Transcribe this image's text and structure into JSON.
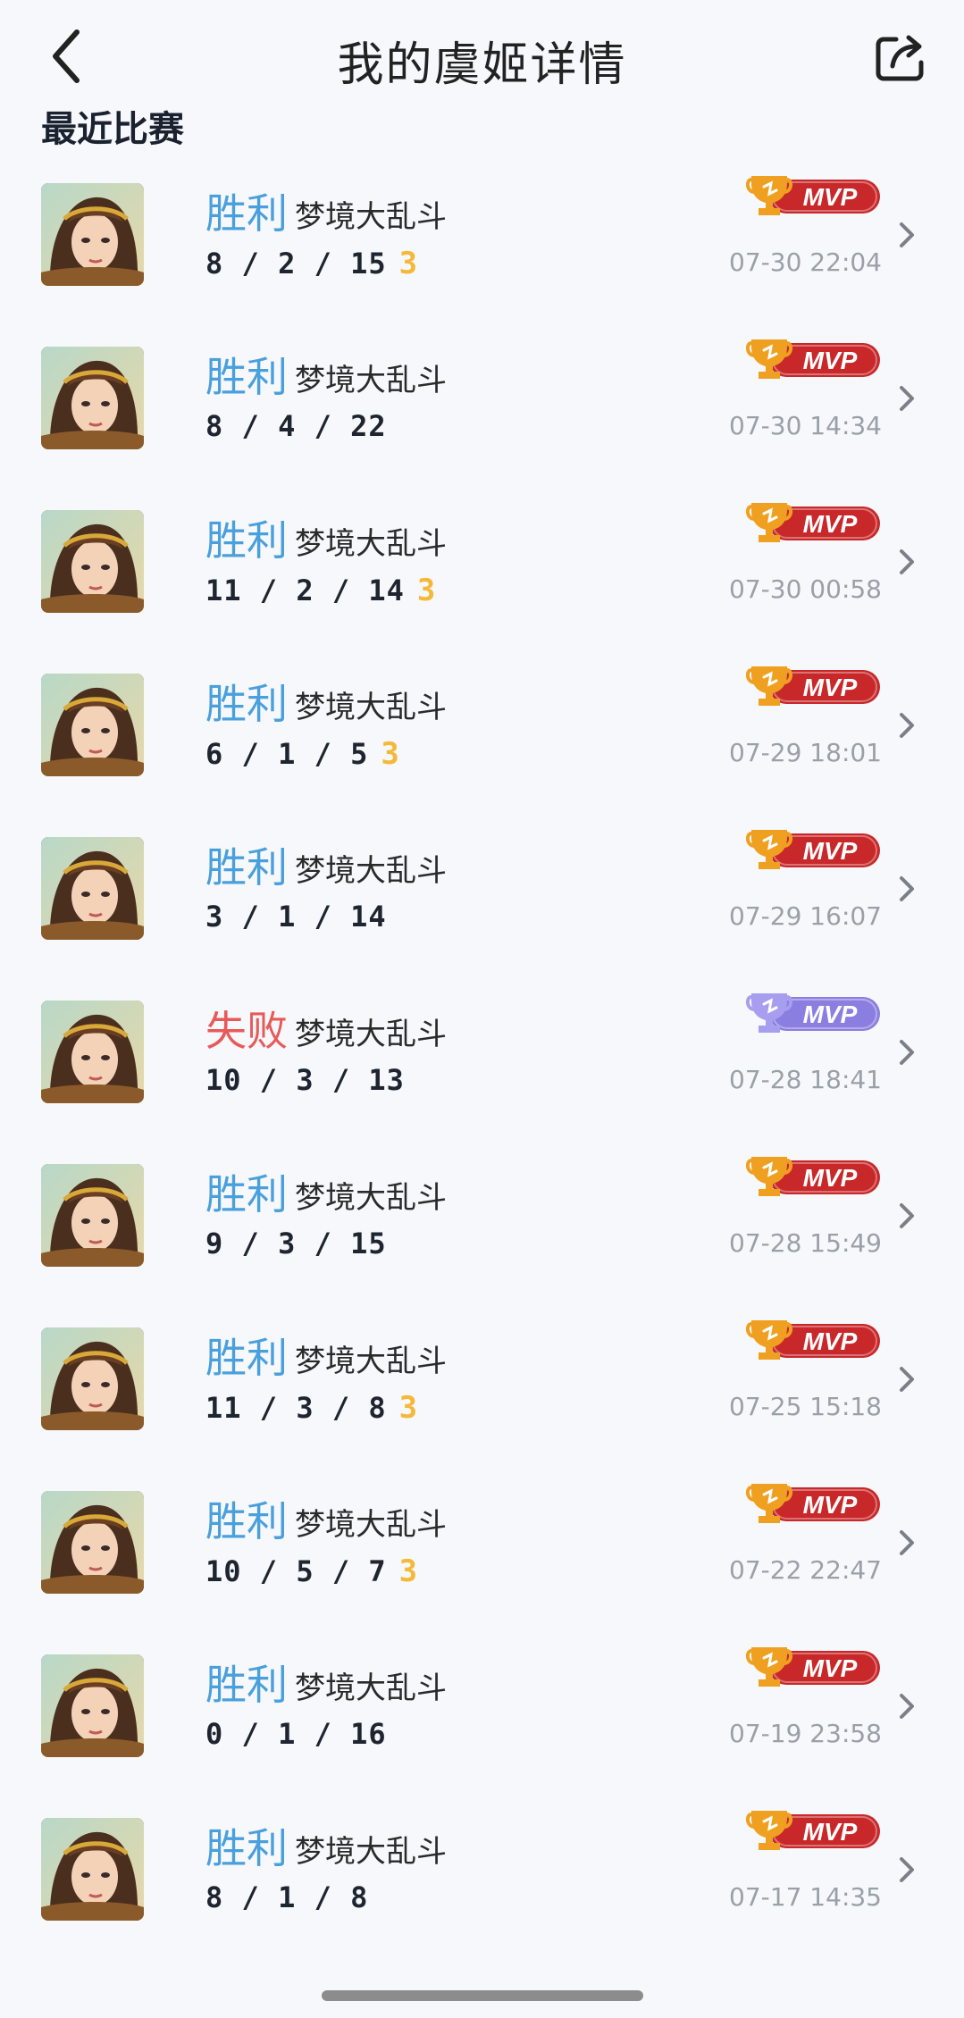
{
  "header": {
    "title": "我的虞姬详情"
  },
  "section": {
    "title": "最近比赛"
  },
  "matches": [
    {
      "result": "胜利",
      "mode": "梦境大乱斗",
      "kda": "8 / 2 / 15",
      "streak": "3",
      "time": "07-30 22:04"
    },
    {
      "result": "胜利",
      "mode": "梦境大乱斗",
      "kda": "8 / 4 / 22",
      "streak": "",
      "time": "07-30 14:34"
    },
    {
      "result": "胜利",
      "mode": "梦境大乱斗",
      "kda": "11 / 2 / 14",
      "streak": "3",
      "time": "07-30 00:58"
    },
    {
      "result": "胜利",
      "mode": "梦境大乱斗",
      "kda": "6 / 1 / 5",
      "streak": "3",
      "time": "07-29 18:01"
    },
    {
      "result": "胜利",
      "mode": "梦境大乱斗",
      "kda": "3 / 1 / 14",
      "streak": "",
      "time": "07-29 16:07"
    },
    {
      "result": "失败",
      "mode": "梦境大乱斗",
      "kda": "10 / 3 / 13",
      "streak": "",
      "time": "07-28 18:41"
    },
    {
      "result": "胜利",
      "mode": "梦境大乱斗",
      "kda": "9 / 3 / 15",
      "streak": "",
      "time": "07-28 15:49"
    },
    {
      "result": "胜利",
      "mode": "梦境大乱斗",
      "kda": "11 / 3 / 8",
      "streak": "3",
      "time": "07-25 15:18"
    },
    {
      "result": "胜利",
      "mode": "梦境大乱斗",
      "kda": "10 / 5 / 7",
      "streak": "3",
      "time": "07-22 22:47"
    },
    {
      "result": "胜利",
      "mode": "梦境大乱斗",
      "kda": "0 / 1 / 16",
      "streak": "",
      "time": "07-19 23:58"
    },
    {
      "result": "胜利",
      "mode": "梦境大乱斗",
      "kda": "8 / 1 / 8",
      "streak": "",
      "time": "07-17 14:35"
    }
  ],
  "badge": {
    "label": "MVP"
  },
  "colors": {
    "win": "#4aa0dc",
    "lose": "#e85a5a",
    "mvp_win": "#c8282a",
    "mvp_lose": "#8a7ee0",
    "trophy_win": "#f0a020",
    "trophy_lose": "#a79ef0",
    "streak": "#f5b93a"
  },
  "icons": {
    "back": "chevron-left-icon",
    "share": "share-icon",
    "chevron": "chevron-right-icon"
  }
}
